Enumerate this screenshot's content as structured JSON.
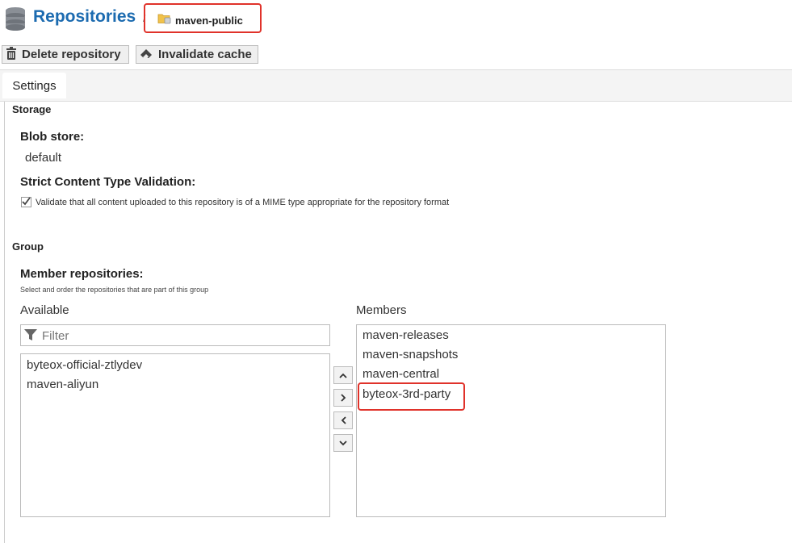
{
  "header": {
    "title": "Repositories",
    "separator": "/",
    "breadcrumb_current": "maven-public"
  },
  "toolbar": {
    "delete_label": "Delete repository",
    "invalidate_label": "Invalidate cache"
  },
  "tabs": [
    {
      "label": "Settings"
    }
  ],
  "storage": {
    "section_title": "Storage",
    "blob_store_label": "Blob store:",
    "blob_store_value": "default",
    "strict_label": "Strict Content Type Validation:",
    "strict_checkbox_text": "Validate that all content uploaded to this repository is of a MIME type appropriate for the repository format",
    "strict_checked": true
  },
  "group": {
    "section_title": "Group",
    "member_label": "Member repositories:",
    "member_help": "Select and order the repositories that are part of this group",
    "available_label": "Available",
    "filter_placeholder": "Filter",
    "available_items": [
      "byteox-official-ztlydev",
      "maven-aliyun"
    ],
    "members_label": "Members",
    "members_items": [
      "maven-releases",
      "maven-snapshots",
      "maven-central",
      "byteox-3rd-party"
    ]
  },
  "colors": {
    "accent": "#1c6bb0",
    "highlight": "#e0322a"
  }
}
